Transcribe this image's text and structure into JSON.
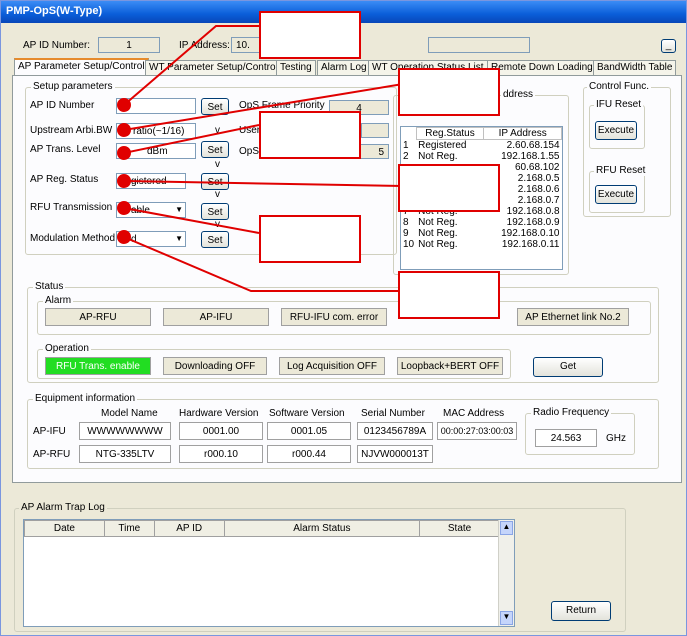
{
  "window": {
    "title": "PMP-OpS(W-Type)"
  },
  "top": {
    "ap_id_label": "AP ID Number:",
    "ap_id_value": "1",
    "ip_label": "IP Address:",
    "ip_value": "10.",
    "minimize": "_"
  },
  "tabs": [
    {
      "label": "AP Parameter Setup/Control"
    },
    {
      "label": "WT Parameter Setup/Control"
    },
    {
      "label": "Testing"
    },
    {
      "label": "Alarm Log"
    },
    {
      "label": "WT Operation Status List"
    },
    {
      "label": "Remote Down Loading"
    },
    {
      "label": "BandWidth Table"
    }
  ],
  "setup": {
    "title": "Setup parameters",
    "rows": [
      {
        "label": "AP ID Number",
        "value": "",
        "set": "Set"
      },
      {
        "label": "Upstream Arbi.BW",
        "value": "ratio(~1/16)",
        "set": ""
      },
      {
        "label": "AP Trans. Level",
        "value": "dBm",
        "set": "Set"
      },
      {
        "label": "AP Reg. Status",
        "value": "gistered",
        "set": "Set"
      },
      {
        "label": "RFU Transmission",
        "value": "able",
        "set": "Set"
      },
      {
        "label": "Modulation Method",
        "value": "d",
        "set": "Set"
      }
    ],
    "ops_frame_priority_label": "OpS Frame Priority",
    "ops_frame_priority_value": "4",
    "user_label": "User",
    "ops2_label": "OpS",
    "ops2_value": "5",
    "v_marks": [
      "v",
      "v",
      "v",
      "v",
      "v"
    ]
  },
  "wt_address": {
    "title": "ddress",
    "headers": [
      "Reg.Status",
      "IP Address"
    ],
    "rows": [
      {
        "n": "1",
        "status": "Registered",
        "ip": "2.60.68.154"
      },
      {
        "n": "2",
        "status": "Not Reg.",
        "ip": "192.168.1.55"
      },
      {
        "n": "",
        "status": "",
        "ip": "60.68.102"
      },
      {
        "n": "",
        "status": "",
        "ip": "2.168.0.5"
      },
      {
        "n": "",
        "status": "",
        "ip": "2.168.0.6"
      },
      {
        "n": "",
        "status": "",
        "ip": "2.168.0.7"
      },
      {
        "n": "7",
        "status": "Not Reg.",
        "ip": "192.168.0.8"
      },
      {
        "n": "8",
        "status": "Not Reg.",
        "ip": "192.168.0.9"
      },
      {
        "n": "9",
        "status": "Not Reg.",
        "ip": "192.168.0.10"
      },
      {
        "n": "10",
        "status": "Not Reg.",
        "ip": "192.168.0.11"
      }
    ]
  },
  "control": {
    "title": "Control Func.",
    "ifu_reset": "IFU Reset",
    "rfu_reset": "RFU Reset",
    "execute": "Execute"
  },
  "status": {
    "title": "Status",
    "alarm_title": "Alarm",
    "alarms": [
      "AP-RFU",
      "AP-IFU",
      "RFU-IFU com. error",
      "AP Ethernet link No.2"
    ],
    "operation_title": "Operation",
    "ops": [
      "RFU Trans. enable",
      "Downloading OFF",
      "Log Acquisition OFF",
      "Loopback+BERT OFF"
    ],
    "get": "Get",
    "enable_color": "#22dd22"
  },
  "equipment": {
    "title": "Equipment information",
    "headers": [
      "Model Name",
      "Hardware Version",
      "Software Version",
      "Serial Number",
      "MAC Address"
    ],
    "rows": [
      {
        "label": "AP-IFU",
        "model": "WWWWWWWW",
        "hw": "0001.00",
        "sw": "0001.05",
        "serial": "0123456789A",
        "mac": "00:00:27:03:00:03"
      },
      {
        "label": "AP-RFU",
        "model": "NTG-335LTV",
        "hw": "r000.10",
        "sw": "r000.44",
        "serial": "NJVW000013T",
        "mac": ""
      }
    ],
    "radio_title": "Radio Frequency",
    "radio_value": "24.563",
    "radio_unit": "GHz"
  },
  "trap": {
    "title": "AP Alarm Trap Log",
    "headers": [
      "Date",
      "Time",
      "AP ID",
      "Alarm Status",
      "State"
    ],
    "return": "Return"
  },
  "annotation_color": "#e00000"
}
